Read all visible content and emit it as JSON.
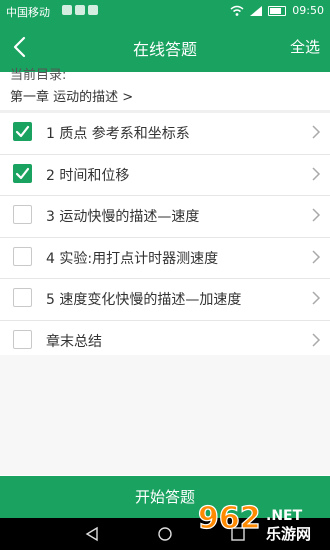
{
  "status": {
    "carrier": "中国移动",
    "time": "09:50"
  },
  "header": {
    "title": "在线答题",
    "select_all": "全选"
  },
  "directory": {
    "label": "当前目录:",
    "path": "第一章 运动的描述 >"
  },
  "items": [
    {
      "label": "1 质点 参考系和坐标系",
      "checked": true
    },
    {
      "label": "2 时间和位移",
      "checked": true
    },
    {
      "label": "3 运动快慢的描述—速度",
      "checked": false
    },
    {
      "label": "4 实验:用打点计时器测速度",
      "checked": false
    },
    {
      "label": "5 速度变化快慢的描述—加速度",
      "checked": false
    },
    {
      "label": "章末总结",
      "checked": false
    }
  ],
  "footer": {
    "start_label": "开始答题"
  },
  "watermark": {
    "number": "962",
    "suffix": ".NET",
    "site": "乐游网"
  },
  "colors": {
    "accent": "#1aa260",
    "separator": "#e6e6e6"
  }
}
